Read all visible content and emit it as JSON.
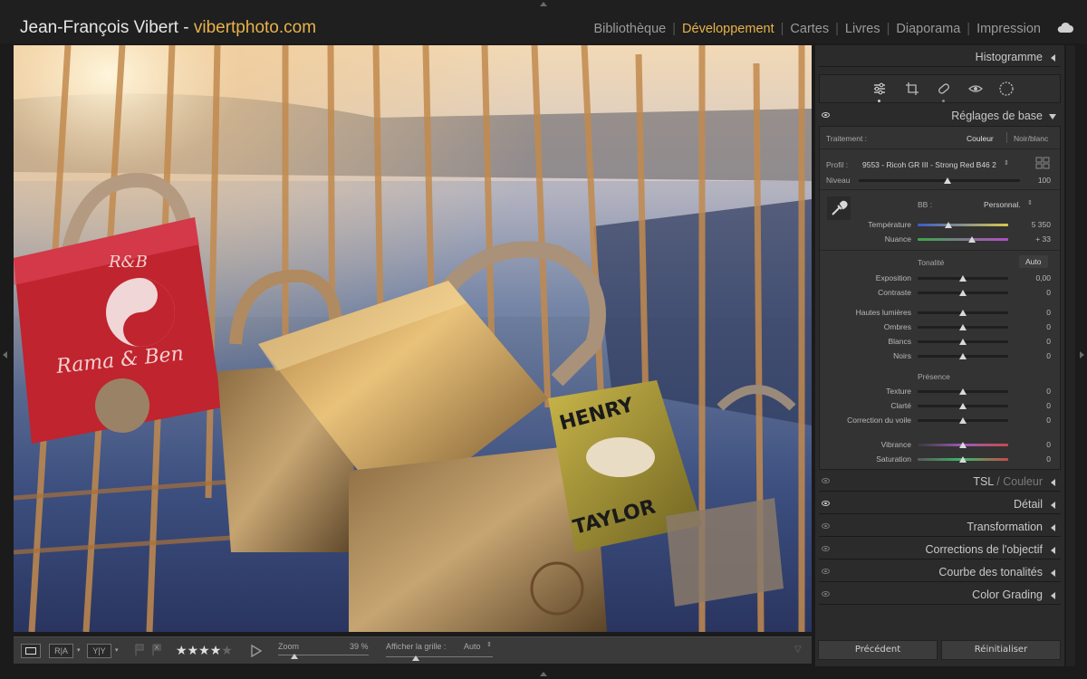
{
  "header": {
    "name": "Jean-François Vibert - ",
    "site": "vibertphoto.com",
    "modules": [
      "Bibliothèque",
      "Développement",
      "Cartes",
      "Livres",
      "Diaporama",
      "Impression"
    ],
    "active_module": "Développement"
  },
  "colors": {
    "accent": "#e8b24a",
    "panel": "#2b2b2b",
    "section": "#333333"
  },
  "panels": {
    "histogram": "Histogramme",
    "basic": "Réglages de base",
    "hsl_a": "TSL",
    "hsl_sep": " / ",
    "hsl_b": "Couleur",
    "detail": "Détail",
    "transform": "Transformation",
    "lens": "Corrections de l'objectif",
    "curve": "Courbe des tonalités",
    "grading": "Color Grading"
  },
  "basic": {
    "treatment_label": "Traitement :",
    "color": "Couleur",
    "bw": "Noir/blanc",
    "profile_label": "Profil :",
    "profile_value": "9553 - Ricoh GR III - Strong Red B46 2",
    "amount_label": "Niveau",
    "amount_value": "100",
    "amount_fraction": 0.55,
    "wb_label": "BB :",
    "wb_value": "Personnal.",
    "temp_label": "Température",
    "temp_value": "5 350",
    "temp_fraction": 0.34,
    "tint_label": "Nuance",
    "tint_value": "+ 33",
    "tint_fraction": 0.6,
    "tone_label": "Tonalité",
    "auto_label": "Auto",
    "tone": [
      {
        "label": "Exposition",
        "value": "0,00"
      },
      {
        "label": "Contraste",
        "value": "0"
      },
      {
        "label": "Hautes lumières",
        "value": "0"
      },
      {
        "label": "Ombres",
        "value": "0"
      },
      {
        "label": "Blancs",
        "value": "0"
      },
      {
        "label": "Noirs",
        "value": "0"
      }
    ],
    "presence_label": "Présence",
    "presence": [
      {
        "label": "Texture",
        "value": "0"
      },
      {
        "label": "Clarté",
        "value": "0"
      },
      {
        "label": "Correction du voile",
        "value": "0"
      },
      {
        "label": "Vibrance",
        "value": "0"
      },
      {
        "label": "Saturation",
        "value": "0"
      }
    ]
  },
  "toolbar": {
    "view_compare_a": "R|A",
    "view_compare_b": "Y|Y",
    "rating": 4,
    "rating_max": 5,
    "zoom_label": "Zoom",
    "zoom_value": "39 %",
    "grid_label": "Afficher la grille :",
    "grid_value": "Auto"
  },
  "buttons": {
    "previous": "Précédent",
    "reset": "Réinitialiser"
  }
}
